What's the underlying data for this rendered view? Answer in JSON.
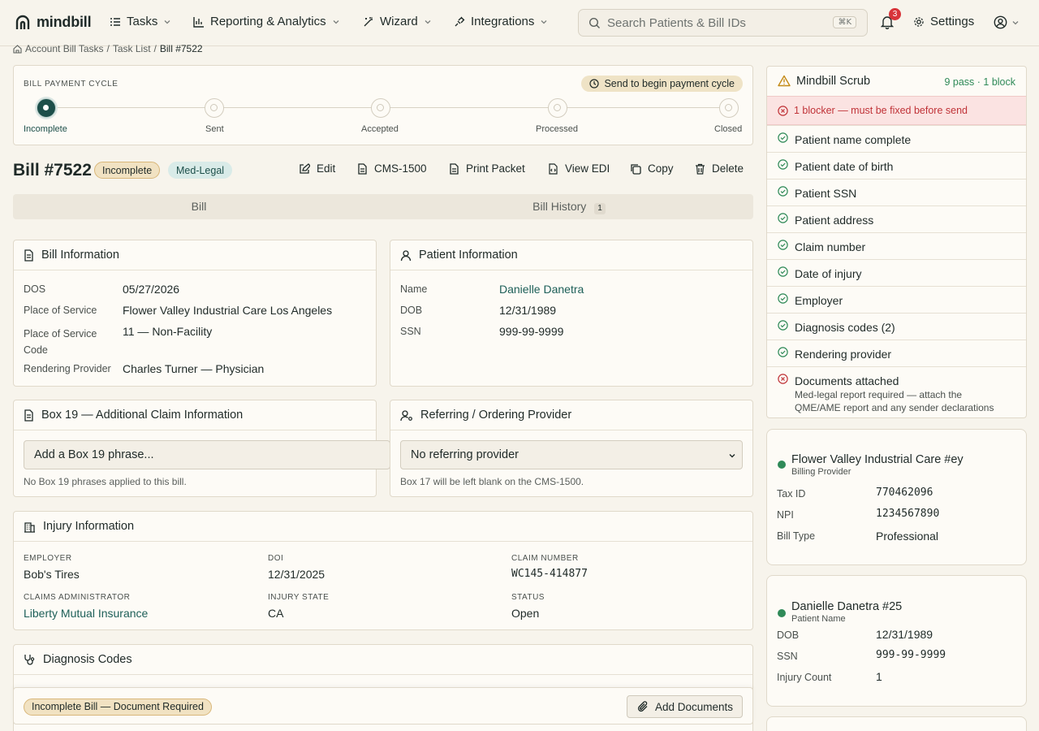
{
  "brand": {
    "name": "mindbill"
  },
  "nav": {
    "items": [
      {
        "label": "Tasks"
      },
      {
        "label": "Reporting & Analytics"
      },
      {
        "label": "Wizard"
      },
      {
        "label": "Integrations"
      }
    ],
    "search_placeholder": "Search Patients & Bill IDs",
    "search_shortcut": "⌘K",
    "notification_count": "3",
    "settings_label": "Settings"
  },
  "breadcrumb": {
    "items": [
      "Account Bill Tasks",
      "Task List",
      "Bill #7522"
    ]
  },
  "payment_cycle": {
    "label": "BILL PAYMENT CYCLE",
    "action_hint": "Send to begin payment cycle",
    "steps": [
      "Incomplete",
      "Sent",
      "Accepted",
      "Processed",
      "Closed"
    ],
    "current_step": 0
  },
  "bill": {
    "title": "Bill #7522",
    "status": "Incomplete",
    "type": "Med-Legal",
    "actions": [
      "Edit",
      "CMS-1500",
      "Print Packet",
      "View EDI",
      "Copy",
      "Delete"
    ]
  },
  "tabs": [
    {
      "label": "Bill"
    },
    {
      "label": "Bill History",
      "count": "1"
    }
  ],
  "bill_info": {
    "title": "Bill Information",
    "rows": [
      {
        "label": "DOS",
        "value": "05/27/2026"
      },
      {
        "label": "Place of Service",
        "value": "Flower Valley Industrial Care Los Angeles"
      },
      {
        "label": "Place of Service Code",
        "value": "11 — Non-Facility"
      },
      {
        "label": "Rendering Provider",
        "value": "Charles Turner — Physician"
      }
    ]
  },
  "patient_info": {
    "title": "Patient Information",
    "rows": [
      {
        "label": "Name",
        "value": "Danielle Danetra"
      },
      {
        "label": "DOB",
        "value": "12/31/1989"
      },
      {
        "label": "SSN",
        "value": "999-99-9999"
      }
    ]
  },
  "box19": {
    "title": "Box 19 — Additional Claim Information",
    "placeholder": "Add a Box 19 phrase...",
    "hint": "No Box 19 phrases applied to this bill."
  },
  "referring": {
    "title": "Referring / Ordering Provider",
    "selected": "No referring provider",
    "hint": "Box 17 will be left blank on the CMS-1500."
  },
  "injury": {
    "title": "Injury Information",
    "fields": [
      {
        "label": "EMPLOYER",
        "value": "Bob's Tires"
      },
      {
        "label": "DOI",
        "value": "12/31/2025"
      },
      {
        "label": "CLAIM NUMBER",
        "value": "WC145-414877"
      },
      {
        "label": "CLAIMS ADMINISTRATOR",
        "value": "Liberty Mutual Insurance"
      },
      {
        "label": "INJURY STATE",
        "value": "CA"
      },
      {
        "label": "STATUS",
        "value": "Open"
      }
    ]
  },
  "diagnosis": {
    "title": "Diagnosis Codes"
  },
  "bottom_bar": {
    "warning": "Incomplete Bill — Document Required",
    "add_documents": "Add Documents"
  },
  "scrub": {
    "title": "Mindbill Scrub",
    "summary": "9 pass · 1 block",
    "blocker": "1 blocker — must be fixed before send",
    "checks": [
      {
        "label": "Patient name complete",
        "status": "pass"
      },
      {
        "label": "Patient date of birth",
        "status": "pass"
      },
      {
        "label": "Patient SSN",
        "status": "pass"
      },
      {
        "label": "Patient address",
        "status": "pass"
      },
      {
        "label": "Claim number",
        "status": "pass"
      },
      {
        "label": "Date of injury",
        "status": "pass"
      },
      {
        "label": "Employer",
        "status": "pass"
      },
      {
        "label": "Diagnosis codes (2)",
        "status": "pass"
      },
      {
        "label": "Rendering provider",
        "status": "pass"
      },
      {
        "label": "Documents attached",
        "status": "block",
        "detail_line1": "Med-legal report required — attach the",
        "detail_line2": "QME/AME report and any sender declarations"
      }
    ]
  },
  "billing_provider": {
    "name": "Flower Valley Industrial Care #ey",
    "role": "Billing Provider",
    "rows": [
      {
        "label": "Tax ID",
        "value": "770462096"
      },
      {
        "label": "NPI",
        "value": "1234567890"
      },
      {
        "label": "Bill Type",
        "value": "Professional"
      }
    ]
  },
  "patient_card": {
    "name": "Danielle Danetra #25",
    "role": "Patient Name",
    "rows": [
      {
        "label": "DOB",
        "value": "12/31/1989"
      },
      {
        "label": "SSN",
        "value": "999-99-9999"
      },
      {
        "label": "Injury Count",
        "value": "1"
      }
    ]
  },
  "colors": {
    "accent": "#1d4f4a",
    "pass": "#2f8a58",
    "block": "#d8343a",
    "warning_bg": "#f1e2c2"
  }
}
